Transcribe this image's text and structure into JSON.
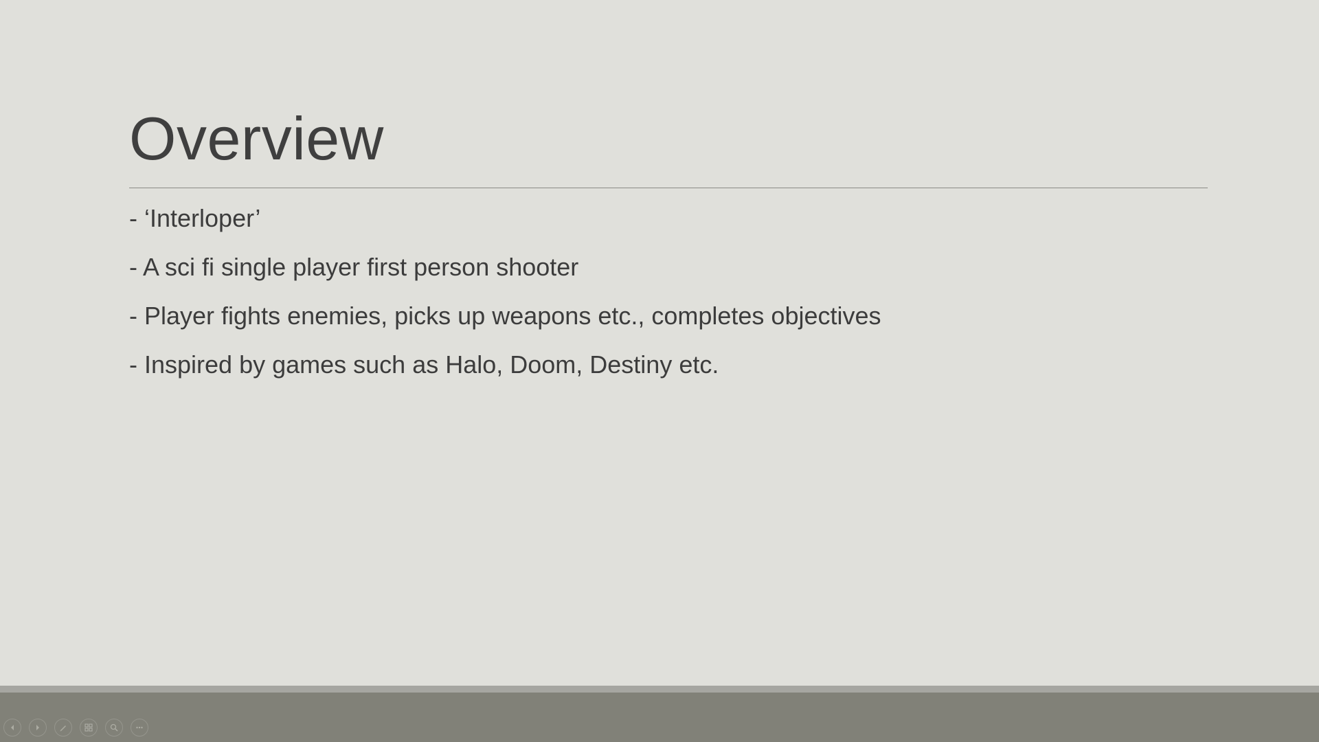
{
  "slide": {
    "title": "Overview",
    "bullets": [
      "- ‘Interloper’",
      "- A sci fi single player first person shooter",
      "- Player fights enemies, picks up weapons etc., completes objectives",
      "- Inspired by games such as Halo, Doom, Destiny etc."
    ]
  },
  "controls": {
    "icons": [
      "previous-slide-icon",
      "next-slide-icon",
      "pen-icon",
      "slide-grid-icon",
      "zoom-icon",
      "more-options-icon"
    ]
  },
  "colors": {
    "slide_background": "#e0e0db",
    "title_text": "#3f3f3f",
    "body_text": "#3c3c3c",
    "bottom_bar": "#818178"
  }
}
